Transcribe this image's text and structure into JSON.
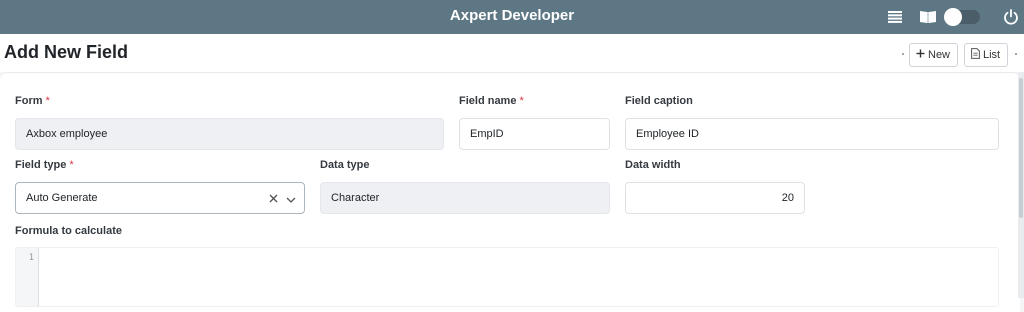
{
  "app": {
    "title": "Axpert Developer"
  },
  "topbar": {
    "icons": [
      "list-icon",
      "book-icon",
      "theme-toggle",
      "power-icon"
    ],
    "theme_toggle_on": false,
    "colors": {
      "bar": "#5e7785"
    }
  },
  "page": {
    "title": "Add New Field"
  },
  "actions": {
    "new_label": "New",
    "new_icon": "plus-icon",
    "list_label": "List",
    "list_icon": "document-icon"
  },
  "form": {
    "required_mark": "*",
    "form_label": "Form",
    "form_value": "Axbox employee",
    "field_name_label": "Field name",
    "field_name_value": "EmpID",
    "field_caption_label": "Field caption",
    "field_caption_value": "Employee ID",
    "field_type_label": "Field type",
    "field_type_value": "Auto Generate",
    "data_type_label": "Data type",
    "data_type_value": "Character",
    "data_width_label": "Data width",
    "data_width_value": "20",
    "formula_label": "Formula to calculate",
    "formula_line_number": "1"
  }
}
